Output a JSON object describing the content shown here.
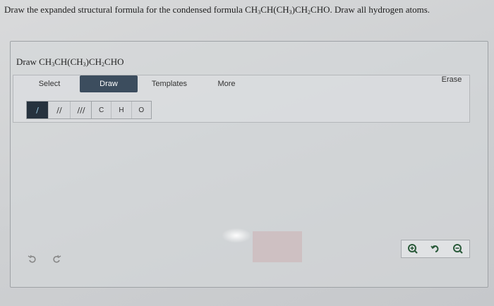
{
  "question": {
    "prefix": "Draw the expanded structural formula for the condensed formula ",
    "formula_parts": [
      "CH",
      "3",
      "CH(CH",
      "3",
      ")CH",
      "2",
      "CHO"
    ],
    "suffix": ". Draw all hydrogen atoms."
  },
  "panel": {
    "title_prefix": "Draw ",
    "title_formula_parts": [
      "CH",
      "3",
      "CH(CH",
      "3",
      ")CH",
      "2",
      "CHO"
    ]
  },
  "toolbar": {
    "tabs": {
      "select": "Select",
      "draw": "Draw",
      "templates": "Templates",
      "more": "More",
      "erase": "Erase"
    },
    "bonds": [
      "/",
      "//",
      "///"
    ],
    "atoms": [
      "C",
      "H",
      "O"
    ]
  },
  "colors": {
    "active_tab": "#3c4d5e",
    "active_bond": "#26323e",
    "icon_green": "#2a5a3a"
  },
  "icons": {
    "undo": "undo-icon",
    "redo": "redo-icon",
    "zoom_in": "zoom-in-icon",
    "reset_zoom": "reset-zoom-icon",
    "zoom_out": "zoom-out-icon"
  }
}
